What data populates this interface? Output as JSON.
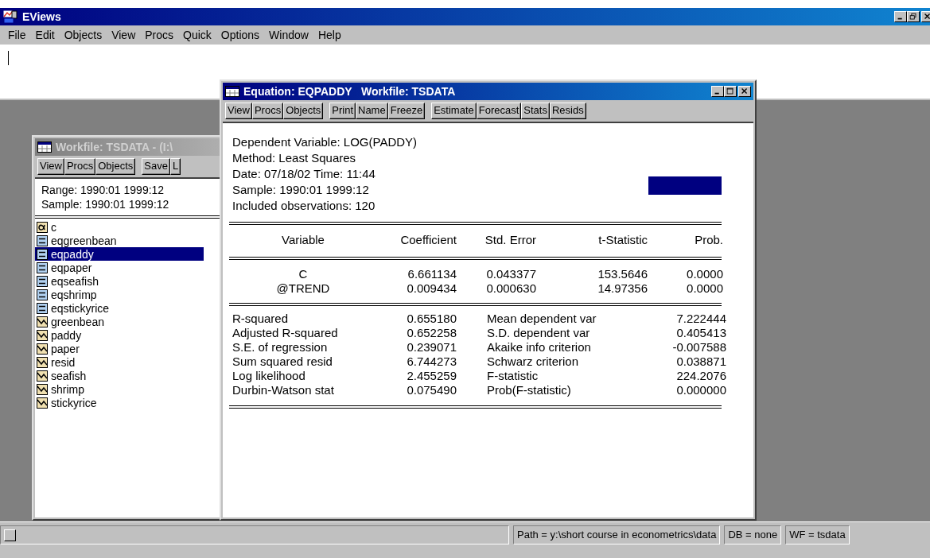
{
  "app": {
    "title": "EViews",
    "menu": [
      "File",
      "Edit",
      "Objects",
      "View",
      "Procs",
      "Quick",
      "Options",
      "Window",
      "Help"
    ]
  },
  "workfile_window": {
    "title": "Workfile: TSDATA - (I:\\",
    "active": false,
    "toolbar": [
      {
        "buttons": [
          "View",
          "Procs",
          "Objects"
        ]
      },
      {
        "buttons": [
          "Save",
          "L"
        ]
      }
    ],
    "range": "Range:  1990:01 1999:12",
    "sample": "Sample: 1990:01 1999:12",
    "objects": [
      {
        "name": "c",
        "kind": "coef",
        "selected": false
      },
      {
        "name": "eqgreenbean",
        "kind": "equation",
        "selected": false
      },
      {
        "name": "eqpaddy",
        "kind": "equation",
        "selected": true
      },
      {
        "name": "eqpaper",
        "kind": "equation",
        "selected": false
      },
      {
        "name": "eqseafish",
        "kind": "equation",
        "selected": false
      },
      {
        "name": "eqshrimp",
        "kind": "equation",
        "selected": false
      },
      {
        "name": "eqstickyrice",
        "kind": "equation",
        "selected": false
      },
      {
        "name": "greenbean",
        "kind": "series",
        "selected": false
      },
      {
        "name": "paddy",
        "kind": "series",
        "selected": false
      },
      {
        "name": "paper",
        "kind": "series",
        "selected": false
      },
      {
        "name": "resid",
        "kind": "series",
        "selected": false
      },
      {
        "name": "seafish",
        "kind": "series",
        "selected": false
      },
      {
        "name": "shrimp",
        "kind": "series",
        "selected": false
      },
      {
        "name": "stickyrice",
        "kind": "series",
        "selected": false
      }
    ]
  },
  "equation_window": {
    "title": "Equation: EQPADDY   Workfile: TSDATA",
    "active": true,
    "toolbar": [
      {
        "buttons": [
          "View",
          "Procs",
          "Objects"
        ]
      },
      {
        "buttons": [
          "Print",
          "Name",
          "Freeze"
        ]
      },
      {
        "buttons": [
          "Estimate",
          "Forecast",
          "Stats",
          "Resids"
        ]
      }
    ],
    "header": [
      "Dependent Variable: LOG(PADDY)",
      "Method: Least Squares",
      "Date: 07/18/02   Time: 11:44",
      "Sample: 1990:01 1999:12",
      "Included observations: 120"
    ],
    "table": {
      "columns": [
        "Variable",
        "Coefficient",
        "Std. Error",
        "t-Statistic",
        "Prob."
      ],
      "rows": [
        [
          "C",
          "6.661134",
          "0.043377",
          "153.5646",
          "0.0000"
        ],
        [
          "@TREND",
          "0.009434",
          "0.000630",
          "14.97356",
          "0.0000"
        ]
      ]
    },
    "statistics": [
      [
        "R-squared",
        "0.655180",
        "Mean dependent var",
        "7.222444"
      ],
      [
        "Adjusted R-squared",
        "0.652258",
        "S.D. dependent var",
        "0.405413"
      ],
      [
        "S.E. of regression",
        "0.239071",
        "Akaike info criterion",
        "-0.007588"
      ],
      [
        "Sum squared resid",
        "6.744273",
        "Schwarz criterion",
        "0.038871"
      ],
      [
        "Log likelihood",
        "2.455259",
        "F-statistic",
        "224.2076"
      ],
      [
        "Durbin-Watson stat",
        "0.075490",
        "Prob(F-statistic)",
        "0.000000"
      ]
    ]
  },
  "status_bar": {
    "panels": [
      "Path = y:\\short course in econometrics\\data",
      "DB = none",
      "WF = tsdata"
    ]
  }
}
